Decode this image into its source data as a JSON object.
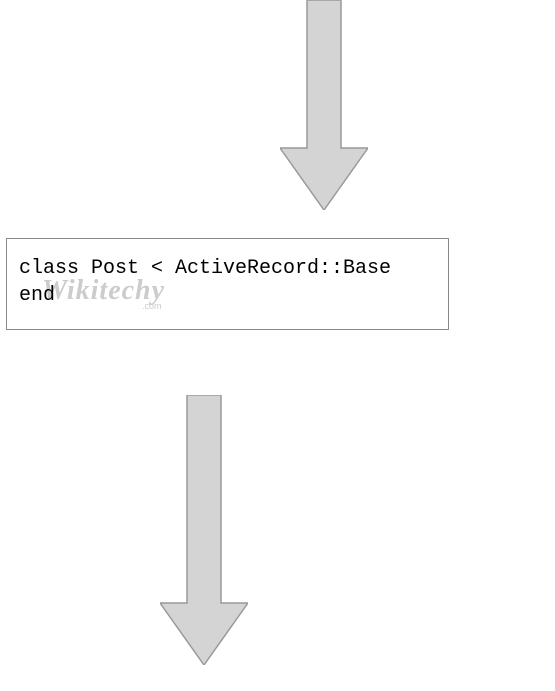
{
  "code": {
    "line1": "class Post < ActiveRecord::Base",
    "line2": "end"
  },
  "watermark": {
    "main": "Wikitechy",
    "sub": ".com"
  },
  "arrows": {
    "fill": "#d4d4d4",
    "stroke": "#999999"
  }
}
